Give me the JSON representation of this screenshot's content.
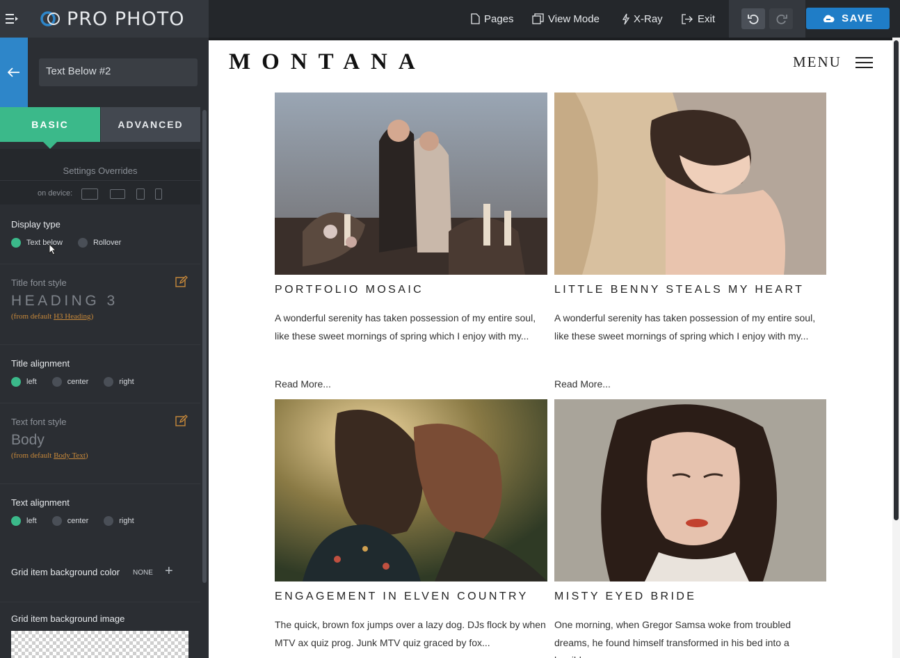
{
  "brand": {
    "name": "PRO PHOTO"
  },
  "panel": {
    "title_value": "Text Below #2",
    "tabs": [
      {
        "label": "BASIC"
      },
      {
        "label": "ADVANCED"
      }
    ],
    "overrides": {
      "title": "Settings Overrides",
      "device_label": "on device:"
    },
    "display_type": {
      "label": "Display type",
      "options": [
        "Text below",
        "Rollover"
      ],
      "selected": "Text below"
    },
    "title_font": {
      "label": "Title font style",
      "value": "HEADING 3",
      "from_prefix": "(from default ",
      "from_link": "H3 Heading",
      "from_suffix": ")"
    },
    "title_alignment": {
      "label": "Title alignment",
      "options": [
        "left",
        "center",
        "right"
      ],
      "selected": "left"
    },
    "text_font": {
      "label": "Text font style",
      "value": "Body",
      "from_prefix": "(from default ",
      "from_link": "Body Text",
      "from_suffix": ")"
    },
    "text_alignment": {
      "label": "Text alignment",
      "options": [
        "left",
        "center",
        "right"
      ],
      "selected": "left"
    },
    "bg_color": {
      "label": "Grid item background color",
      "value": "NONE"
    },
    "bg_image": {
      "label": "Grid item background image"
    }
  },
  "topbar": {
    "pages": "Pages",
    "view_mode": "View Mode",
    "xray": "X-Ray",
    "exit": "Exit",
    "save": "SAVE"
  },
  "site": {
    "logo": "MONTANA",
    "menu": "MENU",
    "posts": [
      {
        "title": "PORTFOLIO MOSAIC",
        "excerpt": "A wonderful serenity has taken possession of my entire soul, like these sweet mornings of spring which I enjoy with my...",
        "read_more": "Read More..."
      },
      {
        "title": "LITTLE BENNY STEALS MY HEART",
        "excerpt": "A wonderful serenity has taken possession of my entire soul, like these sweet mornings of spring which I enjoy with my...",
        "read_more": "Read More..."
      },
      {
        "title": "ENGAGEMENT IN ELVEN COUNTRY",
        "excerpt": "The quick, brown fox jumps over a lazy dog. DJs flock by when MTV ax quiz prog. Junk MTV quiz graced by fox...",
        "read_more": ""
      },
      {
        "title": "MISTY EYED BRIDE",
        "excerpt": "One morning, when Gregor Samsa woke from troubled dreams, he found himself transformed in his bed into a horrible...",
        "read_more": ""
      }
    ]
  },
  "colors": {
    "accent": "#3bb98a",
    "primary": "#1f7dc7",
    "sidebar": "#2b2e33",
    "link": "#c8893a"
  }
}
